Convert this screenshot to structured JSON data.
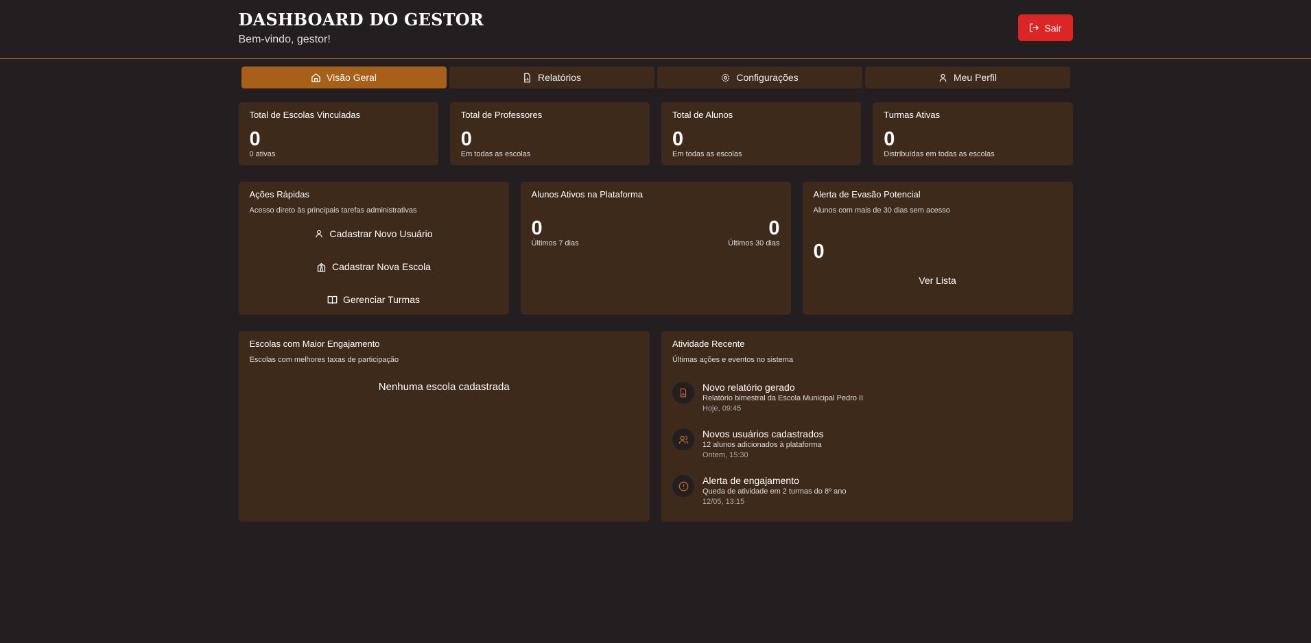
{
  "header": {
    "title": "DASHBOARD DO GESTOR",
    "welcome": "Bem-vindo, gestor!",
    "logout_label": "Sair"
  },
  "tabs": [
    {
      "label": "Visão Geral",
      "icon": "home-icon",
      "active": true
    },
    {
      "label": "Relatórios",
      "icon": "file-chart-icon"
    },
    {
      "label": "Configurações",
      "icon": "gear-icon"
    },
    {
      "label": "Meu Perfil",
      "icon": "user-icon"
    }
  ],
  "stats": [
    {
      "title": "Total de Escolas Vinculadas",
      "value": "0",
      "sub": "0 ativas"
    },
    {
      "title": "Total de Professores",
      "value": "0",
      "sub": "Em todas as escolas"
    },
    {
      "title": "Total de Alunos",
      "value": "0",
      "sub": "Em todas as escolas"
    },
    {
      "title": "Turmas Ativas",
      "value": "0",
      "sub": "Distribuídas em todas as escolas"
    }
  ],
  "quick": {
    "title": "Ações Rápidas",
    "desc": "Acesso direto às principais tarefas administrativas",
    "actions": [
      "Cadastrar Novo Usuário",
      "Cadastrar Nova Escola",
      "Gerenciar Turmas"
    ]
  },
  "active": {
    "title": "Alunos Ativos na Plataforma",
    "v7": "0",
    "l7": "Últimos 7 dias",
    "v30": "0",
    "l30": "Últimos 30 dias"
  },
  "evasion": {
    "title": "Alerta de Evasão Potencial",
    "desc": "Alunos com mais de 30 dias sem acesso",
    "value": "0",
    "button": "Ver Lista"
  },
  "engagement": {
    "title": "Escolas com Maior Engajamento",
    "desc": "Escolas com melhores taxas de participação",
    "empty": "Nenhuma escola cadastrada"
  },
  "recent": {
    "title": "Atividade Recente",
    "desc": "Últimas ações e eventos no sistema",
    "items": [
      {
        "title": "Novo relatório gerado",
        "desc": "Relatório bimestral da Escola Municipal Pedro II",
        "time": "Hoje, 09:45",
        "icon": "file-chart-icon"
      },
      {
        "title": "Novos usuários cadastrados",
        "desc": "12 alunos adicionados à plataforma",
        "time": "Ontem, 15:30",
        "icon": "users-icon"
      },
      {
        "title": "Alerta de engajamento",
        "desc": "Queda de atividade em 2 turmas do 8º ano",
        "time": "12/05, 13:15",
        "icon": "alert-circle-icon"
      }
    ]
  },
  "colors": {
    "background": "#231f20",
    "card": "#3d2a1a",
    "accent": "#a86018",
    "danger": "#dc2626"
  }
}
